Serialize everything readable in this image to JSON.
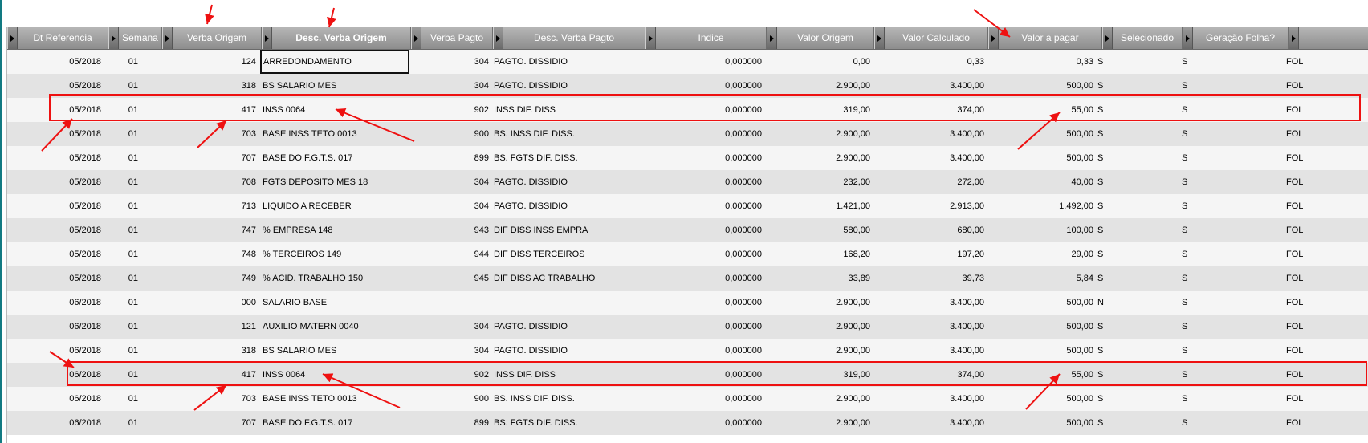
{
  "grid": {
    "columns": [
      {
        "key": "dt",
        "label": "Dt Referencia",
        "bold": false
      },
      {
        "key": "semana",
        "label": "Semana",
        "bold": false
      },
      {
        "key": "verba_origem",
        "label": "Verba Origem",
        "bold": false
      },
      {
        "key": "desc_verba_origem",
        "label": "Desc. Verba Origem",
        "bold": true
      },
      {
        "key": "verba_pagto",
        "label": "Verba Pagto",
        "bold": false
      },
      {
        "key": "desc_verba_pagto",
        "label": "Desc. Verba Pagto",
        "bold": false
      },
      {
        "key": "indice",
        "label": "Indice",
        "bold": false
      },
      {
        "key": "valor_origem",
        "label": "Valor Origem",
        "bold": false
      },
      {
        "key": "valor_calculado",
        "label": "Valor Calculado",
        "bold": false
      },
      {
        "key": "valor_a_pagar",
        "label": "Valor a pagar",
        "bold": false
      },
      {
        "key": "selecionado",
        "label": "Selecionado",
        "bold": false
      },
      {
        "key": "geracao_folha",
        "label": "Geração Folha?",
        "bold": false
      },
      {
        "key": "extra",
        "label": "",
        "bold": false
      }
    ],
    "rows": [
      {
        "dt": "05/2018",
        "semana": "01",
        "verba_origem": "124",
        "desc_verba_origem": "ARREDONDAMENTO",
        "verba_pagto": "304",
        "desc_verba_pagto": "PAGTO. DISSIDIO",
        "indice": "0,000000",
        "valor_origem": "0,00",
        "valor_calculado": "0,33",
        "valor_a_pagar": "0,33",
        "s1": "S",
        "selecionado": "S",
        "geracao_folha": "FOL"
      },
      {
        "dt": "05/2018",
        "semana": "01",
        "verba_origem": "318",
        "desc_verba_origem": "BS SALARIO MES",
        "verba_pagto": "304",
        "desc_verba_pagto": "PAGTO. DISSIDIO",
        "indice": "0,000000",
        "valor_origem": "2.900,00",
        "valor_calculado": "3.400,00",
        "valor_a_pagar": "500,00",
        "s1": "S",
        "selecionado": "S",
        "geracao_folha": "FOL"
      },
      {
        "dt": "05/2018",
        "semana": "01",
        "verba_origem": "417",
        "desc_verba_origem": "INSS 0064",
        "verba_pagto": "902",
        "desc_verba_pagto": "INSS DIF. DISS",
        "indice": "0,000000",
        "valor_origem": "319,00",
        "valor_calculado": "374,00",
        "valor_a_pagar": "55,00",
        "s1": "S",
        "selecionado": "S",
        "geracao_folha": "FOL"
      },
      {
        "dt": "05/2018",
        "semana": "01",
        "verba_origem": "703",
        "desc_verba_origem": "BASE INSS TETO 0013",
        "verba_pagto": "900",
        "desc_verba_pagto": "BS. INSS DIF. DISS.",
        "indice": "0,000000",
        "valor_origem": "2.900,00",
        "valor_calculado": "3.400,00",
        "valor_a_pagar": "500,00",
        "s1": "S",
        "selecionado": "S",
        "geracao_folha": "FOL"
      },
      {
        "dt": "05/2018",
        "semana": "01",
        "verba_origem": "707",
        "desc_verba_origem": "BASE DO F.G.T.S. 017",
        "verba_pagto": "899",
        "desc_verba_pagto": "BS. FGTS DIF. DISS.",
        "indice": "0,000000",
        "valor_origem": "2.900,00",
        "valor_calculado": "3.400,00",
        "valor_a_pagar": "500,00",
        "s1": "S",
        "selecionado": "S",
        "geracao_folha": "FOL"
      },
      {
        "dt": "05/2018",
        "semana": "01",
        "verba_origem": "708",
        "desc_verba_origem": "FGTS DEPOSITO MES 18",
        "verba_pagto": "304",
        "desc_verba_pagto": "PAGTO. DISSIDIO",
        "indice": "0,000000",
        "valor_origem": "232,00",
        "valor_calculado": "272,00",
        "valor_a_pagar": "40,00",
        "s1": "S",
        "selecionado": "S",
        "geracao_folha": "FOL"
      },
      {
        "dt": "05/2018",
        "semana": "01",
        "verba_origem": "713",
        "desc_verba_origem": "LIQUIDO A RECEBER",
        "verba_pagto": "304",
        "desc_verba_pagto": "PAGTO. DISSIDIO",
        "indice": "0,000000",
        "valor_origem": "1.421,00",
        "valor_calculado": "2.913,00",
        "valor_a_pagar": "1.492,00",
        "s1": "S",
        "selecionado": "S",
        "geracao_folha": "FOL"
      },
      {
        "dt": "05/2018",
        "semana": "01",
        "verba_origem": "747",
        "desc_verba_origem": "% EMPRESA  148",
        "verba_pagto": "943",
        "desc_verba_pagto": "DIF DISS INSS EMPRA",
        "indice": "0,000000",
        "valor_origem": "580,00",
        "valor_calculado": "680,00",
        "valor_a_pagar": "100,00",
        "s1": "S",
        "selecionado": "S",
        "geracao_folha": "FOL"
      },
      {
        "dt": "05/2018",
        "semana": "01",
        "verba_origem": "748",
        "desc_verba_origem": "% TERCEIROS 149",
        "verba_pagto": "944",
        "desc_verba_pagto": "DIF DISS TERCEIROS",
        "indice": "0,000000",
        "valor_origem": "168,20",
        "valor_calculado": "197,20",
        "valor_a_pagar": "29,00",
        "s1": "S",
        "selecionado": "S",
        "geracao_folha": "FOL"
      },
      {
        "dt": "05/2018",
        "semana": "01",
        "verba_origem": "749",
        "desc_verba_origem": "% ACID. TRABALHO 150",
        "verba_pagto": "945",
        "desc_verba_pagto": "DIF DISS AC TRABALHO",
        "indice": "0,000000",
        "valor_origem": "33,89",
        "valor_calculado": "39,73",
        "valor_a_pagar": "5,84",
        "s1": "S",
        "selecionado": "S",
        "geracao_folha": "FOL"
      },
      {
        "dt": "06/2018",
        "semana": "01",
        "verba_origem": "000",
        "desc_verba_origem": "SALARIO BASE",
        "verba_pagto": "",
        "desc_verba_pagto": "",
        "indice": "0,000000",
        "valor_origem": "2.900,00",
        "valor_calculado": "3.400,00",
        "valor_a_pagar": "500,00",
        "s1": "N",
        "selecionado": "S",
        "geracao_folha": "FOL"
      },
      {
        "dt": "06/2018",
        "semana": "01",
        "verba_origem": "121",
        "desc_verba_origem": "AUXILIO MATERN 0040",
        "verba_pagto": "304",
        "desc_verba_pagto": "PAGTO. DISSIDIO",
        "indice": "0,000000",
        "valor_origem": "2.900,00",
        "valor_calculado": "3.400,00",
        "valor_a_pagar": "500,00",
        "s1": "S",
        "selecionado": "S",
        "geracao_folha": "FOL"
      },
      {
        "dt": "06/2018",
        "semana": "01",
        "verba_origem": "318",
        "desc_verba_origem": "BS SALARIO MES",
        "verba_pagto": "304",
        "desc_verba_pagto": "PAGTO. DISSIDIO",
        "indice": "0,000000",
        "valor_origem": "2.900,00",
        "valor_calculado": "3.400,00",
        "valor_a_pagar": "500,00",
        "s1": "S",
        "selecionado": "S",
        "geracao_folha": "FOL"
      },
      {
        "dt": "06/2018",
        "semana": "01",
        "verba_origem": "417",
        "desc_verba_origem": "INSS 0064",
        "verba_pagto": "902",
        "desc_verba_pagto": "INSS DIF. DISS",
        "indice": "0,000000",
        "valor_origem": "319,00",
        "valor_calculado": "374,00",
        "valor_a_pagar": "55,00",
        "s1": "S",
        "selecionado": "S",
        "geracao_folha": "FOL"
      },
      {
        "dt": "06/2018",
        "semana": "01",
        "verba_origem": "703",
        "desc_verba_origem": "BASE INSS TETO 0013",
        "verba_pagto": "900",
        "desc_verba_pagto": "BS. INSS DIF. DISS.",
        "indice": "0,000000",
        "valor_origem": "2.900,00",
        "valor_calculado": "3.400,00",
        "valor_a_pagar": "500,00",
        "s1": "S",
        "selecionado": "S",
        "geracao_folha": "FOL"
      },
      {
        "dt": "06/2018",
        "semana": "01",
        "verba_origem": "707",
        "desc_verba_origem": "BASE DO F.G.T.S. 017",
        "verba_pagto": "899",
        "desc_verba_pagto": "BS. FGTS DIF. DISS.",
        "indice": "0,000000",
        "valor_origem": "2.900,00",
        "valor_calculado": "3.400,00",
        "valor_a_pagar": "500,00",
        "s1": "S",
        "selecionado": "S",
        "geracao_folha": "FOL"
      }
    ]
  },
  "annotation_color": "#ee1111"
}
